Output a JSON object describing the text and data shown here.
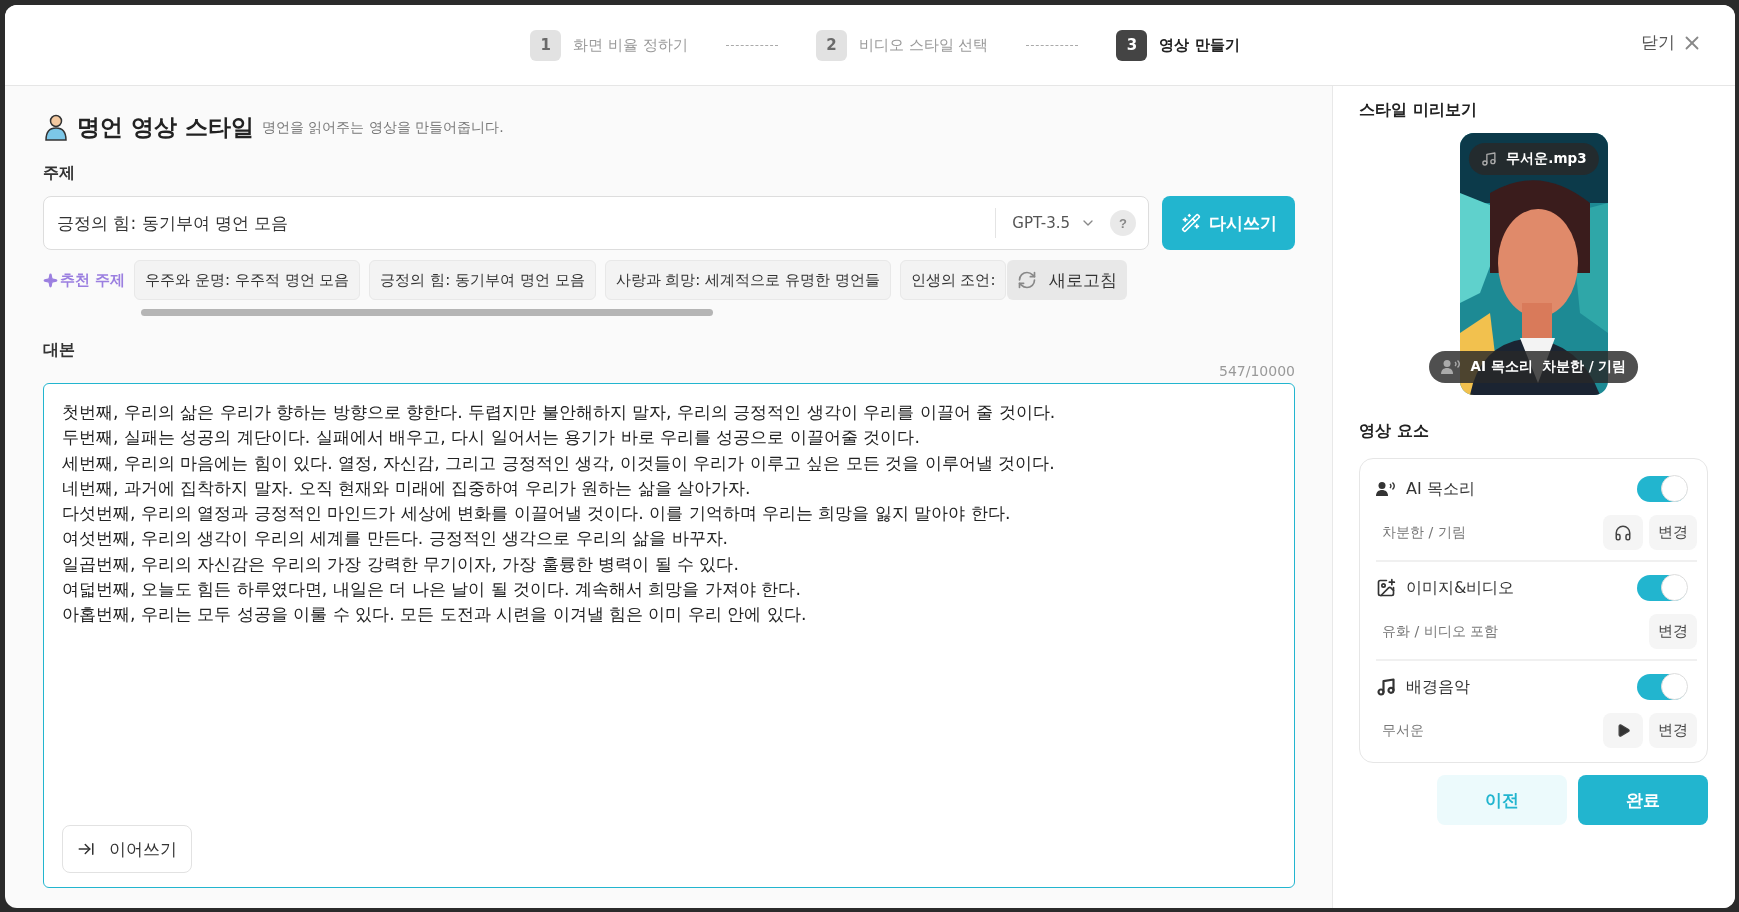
{
  "steps": [
    {
      "number": "1",
      "label": "화면 비율 정하기",
      "selected": false
    },
    {
      "number": "2",
      "label": "비디오 스타일 선택",
      "selected": false
    },
    {
      "number": "3",
      "label": "영상 만들기",
      "selected": true
    }
  ],
  "close": {
    "label": "닫기"
  },
  "style": {
    "title": "명언 영상 스타일",
    "description": "명언을 읽어주는 영상을 만들어줍니다."
  },
  "topic": {
    "label": "주제",
    "value": "긍정의 힘: 동기부여 명언 모음",
    "model": "GPT-3.5",
    "help": "?",
    "rewrite": "다시쓰기"
  },
  "suggestions": {
    "label": "추천 주제",
    "refresh": "새로고침",
    "items": [
      "우주와 운명: 우주적 명언 모음",
      "긍정의 힘: 동기부여 명언 모음",
      "사랑과 희망: 세계적으로 유명한 명언들",
      "인생의 조언:"
    ]
  },
  "script": {
    "label": "대본",
    "counter": "547/10000",
    "continue": "이어쓰기",
    "lines": [
      "첫번째, 우리의 삶은 우리가 향하는 방향으로 향한다. 두렵지만 불안해하지 말자, 우리의 긍정적인 생각이 우리를 이끌어 줄 것이다.",
      "두번째, 실패는 성공의 계단이다. 실패에서 배우고, 다시 일어서는 용기가 바로 우리를 성공으로 이끌어줄 것이다.",
      "세번째, 우리의 마음에는 힘이 있다. 열정, 자신감, 그리고 긍정적인 생각, 이것들이 우리가 이루고 싶은 모든 것을 이루어낼 것이다.",
      "네번째, 과거에 집착하지 말자. 오직 현재와 미래에 집중하여 우리가 원하는 삶을 살아가자.",
      "다섯번째, 우리의 열정과 긍정적인 마인드가 세상에 변화를 이끌어낼 것이다. 이를 기억하며 우리는 희망을 잃지 말아야 한다.",
      "여섯번째, 우리의 생각이 우리의 세계를 만든다. 긍정적인 생각으로 우리의 삶을 바꾸자.",
      "일곱번째, 우리의 자신감은 우리의 가장 강력한 무기이자, 가장 훌륭한 병력이 될 수 있다.",
      "여덟번째, 오늘도 힘든 하루였다면, 내일은 더 나은 날이 될 것이다. 계속해서 희망을 가져야 한다.",
      "아홉번째, 우리는 모두 성공을 이룰 수 있다. 모든 도전과 시련을 이겨낼 힘은 이미 우리 안에 있다."
    ]
  },
  "preview": {
    "title": "스타일 미리보기",
    "music": "무서운.mp3",
    "voice_label": "AI 목소리",
    "voice_value": "차분한 / 기림"
  },
  "elements": {
    "title": "영상 요소",
    "items": [
      {
        "kind": "voice",
        "label": "AI 목소리",
        "on": true,
        "value": "차분한 / 기림",
        "change": "변경"
      },
      {
        "kind": "media",
        "label": "이미지&비디오",
        "on": true,
        "value": "유화 / 비디오 포함",
        "change": "변경"
      },
      {
        "kind": "music",
        "label": "배경음악",
        "on": true,
        "value": "무서운",
        "change": "변경"
      }
    ]
  },
  "buttons": {
    "back": "이전",
    "done": "완료"
  }
}
